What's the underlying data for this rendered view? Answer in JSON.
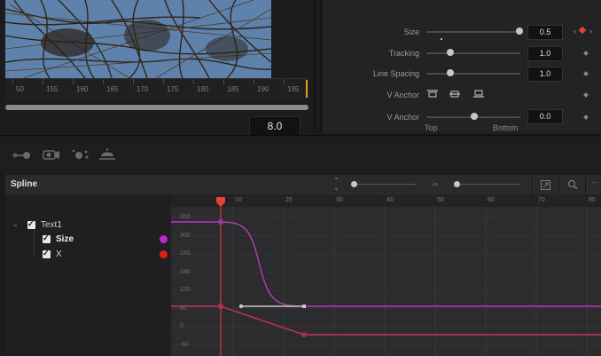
{
  "viewer": {
    "ruler_labels": [
      "50",
      "155",
      "160",
      "165",
      "170",
      "175",
      "180",
      "185",
      "190",
      "195"
    ],
    "time_value": "8.0"
  },
  "inspector": {
    "size": {
      "label": "Size",
      "value": "0.5",
      "slider": 0.5
    },
    "tracking": {
      "label": "Tracking",
      "value": "1.0",
      "slider": 0.2
    },
    "line_spacing": {
      "label": "Line Spacing",
      "value": "1.0",
      "slider": 0.2
    },
    "v_anchor_buttons": {
      "label": "V Anchor"
    },
    "v_anchor_slider": {
      "label": "V Anchor",
      "value": "0.0",
      "slider": 0.5,
      "min_label": "Top",
      "max_label": "Bottom"
    }
  },
  "toolbar": {
    "tools": [
      "link-keyframes-icon",
      "camera-icon",
      "particles-icon",
      "light-icon"
    ]
  },
  "spline": {
    "title": "Spline",
    "tree": {
      "parent": "Text1",
      "children": [
        {
          "label": "Size",
          "color": "#c026d3"
        },
        {
          "label": "X",
          "color": "#e11d1d"
        }
      ]
    },
    "x_ticks": [
      "10",
      "20",
      "30",
      "40",
      "50",
      "60",
      "70",
      "80"
    ],
    "y_ticks": [
      "360",
      "300",
      "240",
      "180",
      "120",
      "60",
      "0",
      "-60"
    ],
    "colors": {
      "size_curve": "#b43bb8",
      "x_curve": "#c8305a",
      "playhead": "#e5423a"
    }
  }
}
